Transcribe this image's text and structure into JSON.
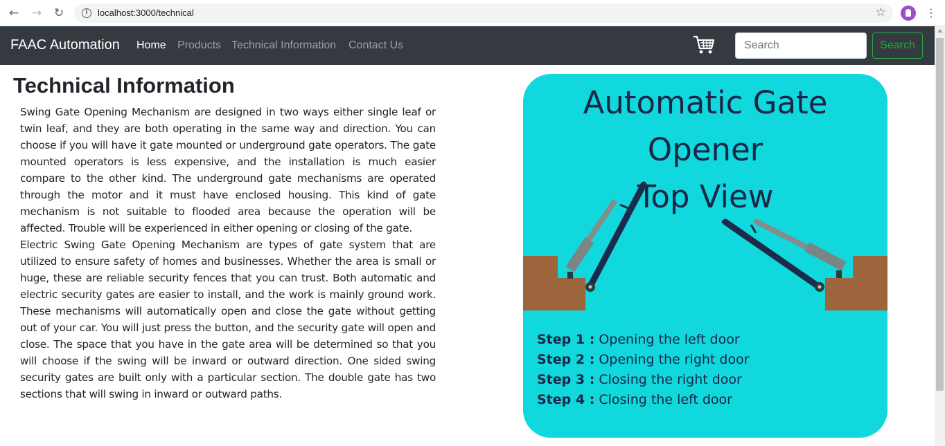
{
  "browser": {
    "url": "localhost:3000/technical"
  },
  "navbar": {
    "brand": "FAAC Automation",
    "links": [
      {
        "label": "Home"
      },
      {
        "label": "Products"
      },
      {
        "label": "Technical Information"
      },
      {
        "label": "Contact Us"
      }
    ],
    "search_placeholder": "Search",
    "search_button": "Search"
  },
  "main": {
    "title": "Technical Information",
    "paragraphs": [
      "Swing Gate Opening Mechanism are designed in two ways either single leaf or twin leaf, and they are both operating in the same way and direction. You can choose if you will have it gate mounted or underground gate operators. The gate mounted operators is less expensive, and the installation is much easier compare to the other kind. The underground gate mechanisms are operated through the motor and it must have enclosed housing. This kind of gate mechanism is not suitable to flooded area because the operation will be affected. Trouble will be experienced in either opening or closing of the gate.",
      "Electric Swing Gate Opening Mechanism are types of gate system that are utilized to ensure safety of homes and businesses. Whether the area is small or huge, these are reliable security fences that you can trust. Both automatic and electric security gates are easier to install, and the work is mainly ground work. These mechanisms will automatically open and close the gate without getting out of your car. You will just press the button, and the security gate will open and close. The space that you have in the gate area will be determined so that you will choose if the swing will be inward or outward direction. One sided swing security gates are built only with a particular section. The double gate has two sections that will swing in inward or outward paths."
    ]
  },
  "card": {
    "title_line1": "Automatic Gate Opener",
    "title_line2": "Top View",
    "steps": [
      {
        "label": "Step 1 :",
        "text": " Opening the left door"
      },
      {
        "label": "Step 2 :",
        "text": " Opening the right door"
      },
      {
        "label": "Step 3 :",
        "text": " Closing the right door"
      },
      {
        "label": "Step 4 :",
        "text": " Closing the left door"
      }
    ],
    "colors": {
      "background": "#10d8dc",
      "text": "#1b2547",
      "pillar": "#9c653c",
      "gate": "#1e2a4a",
      "actuator": "#7f8a8a"
    }
  },
  "colors": {
    "navbar": "#343a40",
    "search_accent": "#28a745"
  }
}
